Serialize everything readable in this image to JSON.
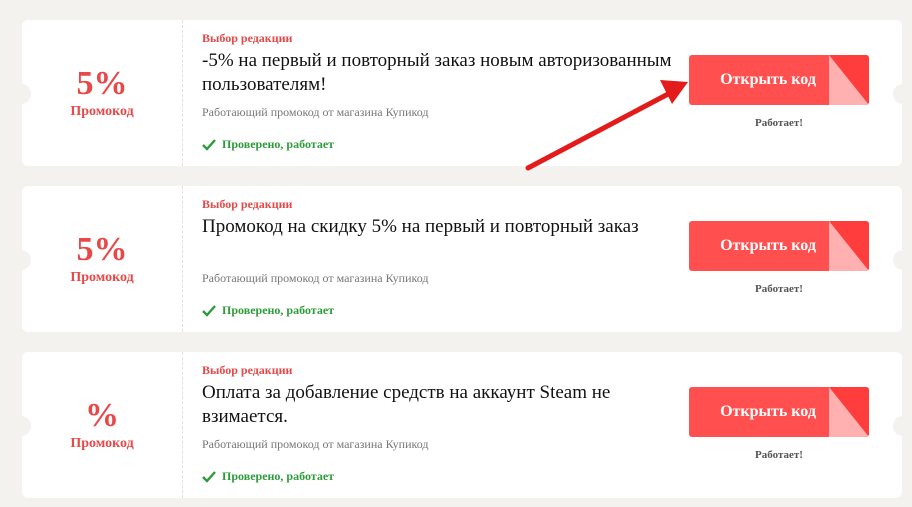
{
  "coupons": [
    {
      "discount": "5%",
      "promo_label": "Промокод",
      "editor_choice": "Выбор редакции",
      "title": "-5% на первый и повторный заказ новым авторизованным пользователям!",
      "source": "Работающий промокод от магазина Купикод",
      "verified": "Проверено, работает",
      "button_label": "Открыть код",
      "status": "Работает!"
    },
    {
      "discount": "5%",
      "promo_label": "Промокод",
      "editor_choice": "Выбор редакции",
      "title": "Промокод на скидку 5% на первый и повторный заказ",
      "source": "Работающий промокод от магазина Купикод",
      "verified": "Проверено, работает",
      "button_label": "Открыть код",
      "status": "Работает!"
    },
    {
      "discount": "%",
      "promo_label": "Промокод",
      "editor_choice": "Выбор редакции",
      "title": "Оплата за добавление средств на аккаунт Steam не взимается.",
      "source": "Работающий промокод от магазина Купикод",
      "verified": "Проверено, работает",
      "button_label": "Открыть код",
      "status": "Работает!"
    }
  ],
  "colors": {
    "accent": "#e84848",
    "button": "#ff4f4f",
    "verified": "#2e9b3a",
    "arrow": "#e41b1b"
  },
  "icons": {
    "verified": "check-icon",
    "annotation": "red-arrow"
  }
}
